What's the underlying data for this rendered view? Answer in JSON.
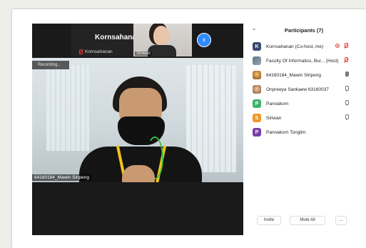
{
  "thumbnails": {
    "tile_big_name": "Kornsahanan",
    "tile_small_name": "Kornsahanan",
    "camera_label": "Siriwan",
    "next_icon": "chevron-right-icon"
  },
  "main_video": {
    "recording_label": "Recording...",
    "speaker_label": "64160184_Mawin Siripeng"
  },
  "participants_panel": {
    "title": "Participants (7)",
    "collapse_icon": "chevron-down-icon",
    "participants": [
      {
        "initial": "K",
        "name": "Kornsahanan (Co-host, me)",
        "avatar_color": "#3a4a6b",
        "video": "on",
        "mic": "muted"
      },
      {
        "initial": "",
        "name": "Faculty Of Informatics, Bur... (Host)",
        "avatar_color": "#7a8a99",
        "video": "none",
        "mic": "muted"
      },
      {
        "initial": "",
        "name": "64160184_Mawin Siripeng",
        "avatar_color": "#c77a2e",
        "video": "none",
        "mic": "speaking"
      },
      {
        "initial": "",
        "name": "Onpreeya Sankaew 63160037",
        "avatar_color": "#d4a080",
        "video": "none",
        "mic": "unmuted"
      },
      {
        "initial": "P",
        "name": "Pannakorn",
        "avatar_color": "#3fb36b",
        "video": "none",
        "mic": "unmuted"
      },
      {
        "initial": "S",
        "name": "Siriwan",
        "avatar_color": "#f0962a",
        "video": "none",
        "mic": "unmuted"
      },
      {
        "initial": "P",
        "name": "Pannakorn Tonglim",
        "avatar_color": "#7a3fa8",
        "video": "none",
        "mic": "none"
      }
    ],
    "footer": {
      "invite_label": "Invite",
      "mute_all_label": "Mute All",
      "more_label": "..."
    }
  }
}
